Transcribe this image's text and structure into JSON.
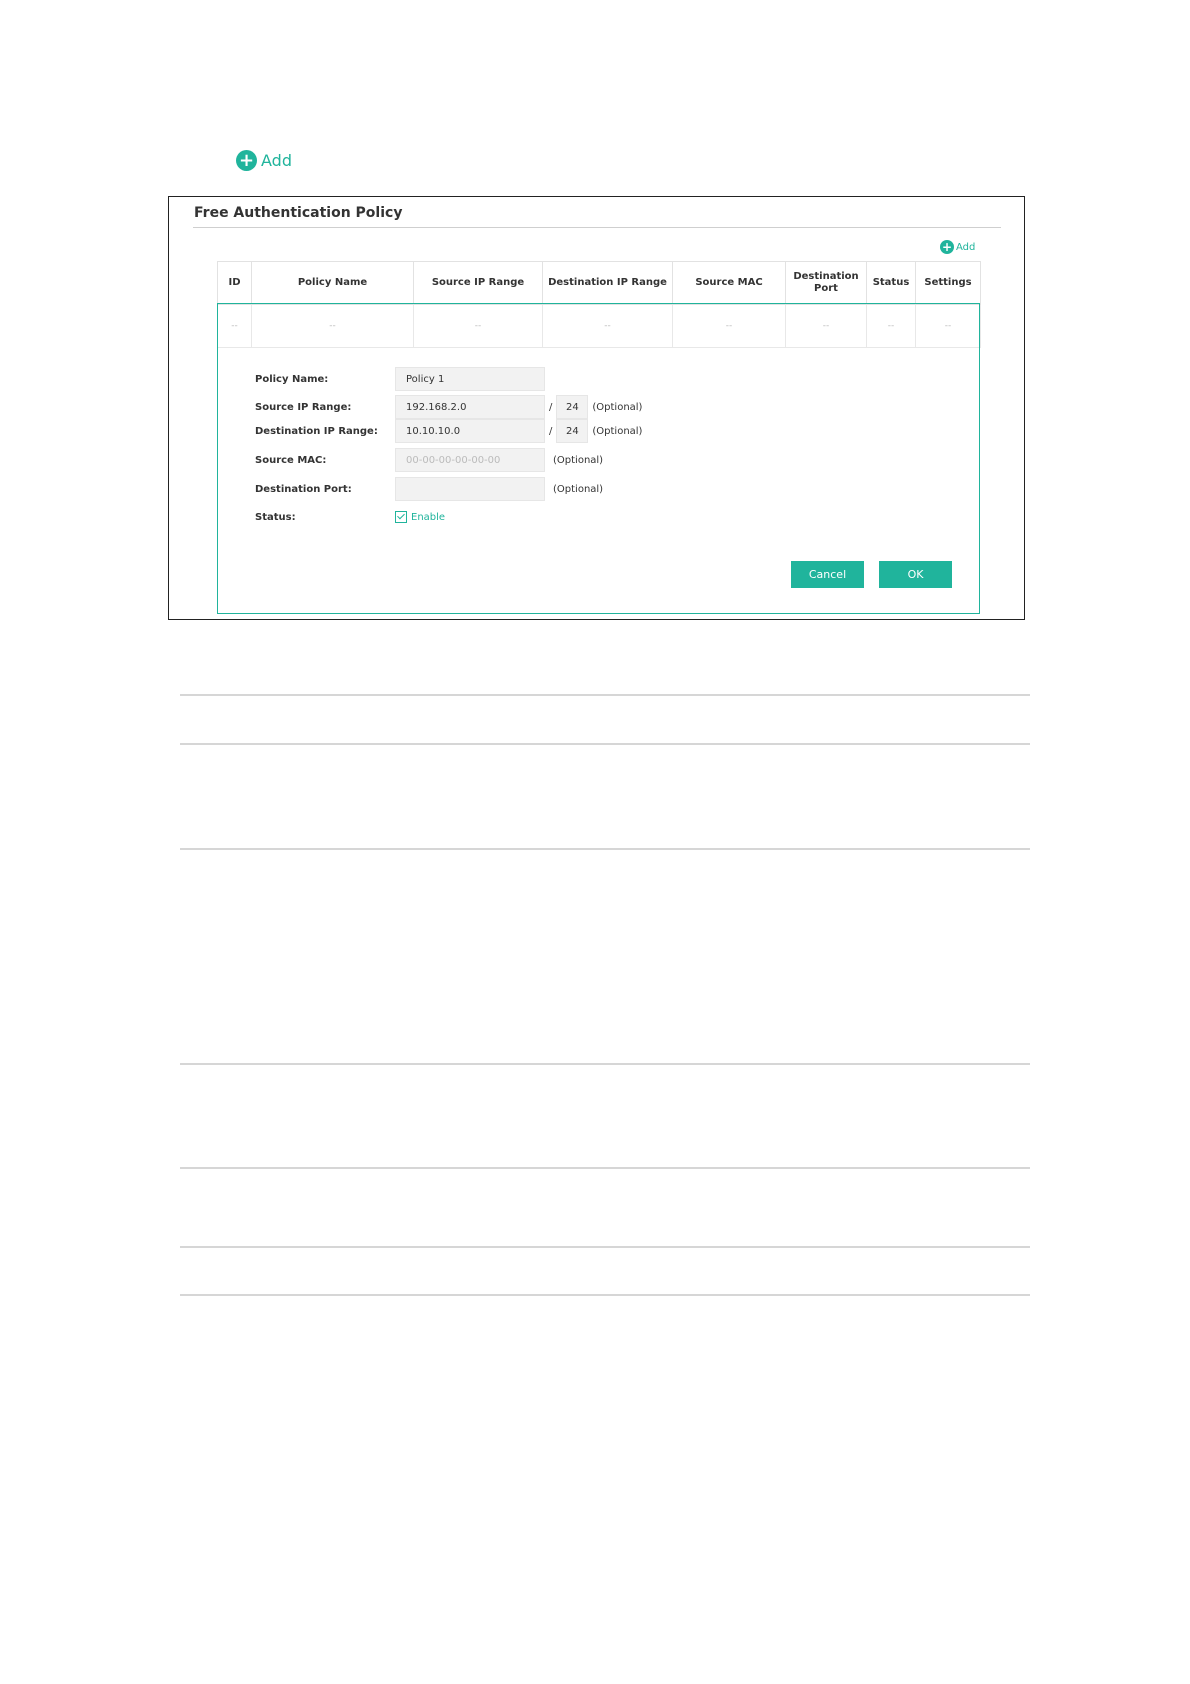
{
  "top_add": {
    "label": "Add"
  },
  "panel": {
    "title": "Free Authentication Policy",
    "add_label": "Add"
  },
  "table": {
    "columns": [
      "ID",
      "Policy Name",
      "Source IP Range",
      "Destination IP Range",
      "Source MAC",
      "Destination Port",
      "Status",
      "Settings"
    ],
    "row": [
      "--",
      "--",
      "--",
      "--",
      "--",
      "--",
      "--",
      "--"
    ]
  },
  "form": {
    "policy_name": {
      "label": "Policy Name:",
      "value": "Policy 1"
    },
    "source_ip": {
      "label": "Source IP Range:",
      "value": "192.168.2.0",
      "slash": "/",
      "mask": "24",
      "optional": "(Optional)"
    },
    "dest_ip": {
      "label": "Destination IP Range:",
      "value": "10.10.10.0",
      "slash": "/",
      "mask": "24",
      "optional": "(Optional)"
    },
    "source_mac": {
      "label": "Source MAC:",
      "placeholder": "00-00-00-00-00-00",
      "optional": "(Optional)"
    },
    "dest_port": {
      "label": "Destination Port:",
      "value": "",
      "optional": "(Optional)"
    },
    "status": {
      "label": "Status:",
      "checkbox_label": "Enable",
      "checked": true
    }
  },
  "buttons": {
    "cancel": "Cancel",
    "ok": "OK"
  },
  "colors": {
    "accent": "#20b49c",
    "frame_border": "#222222",
    "divider": "#d6d6d6"
  },
  "icons": {
    "add": "plus-circle-icon",
    "check": "checkbox-checked-icon"
  }
}
